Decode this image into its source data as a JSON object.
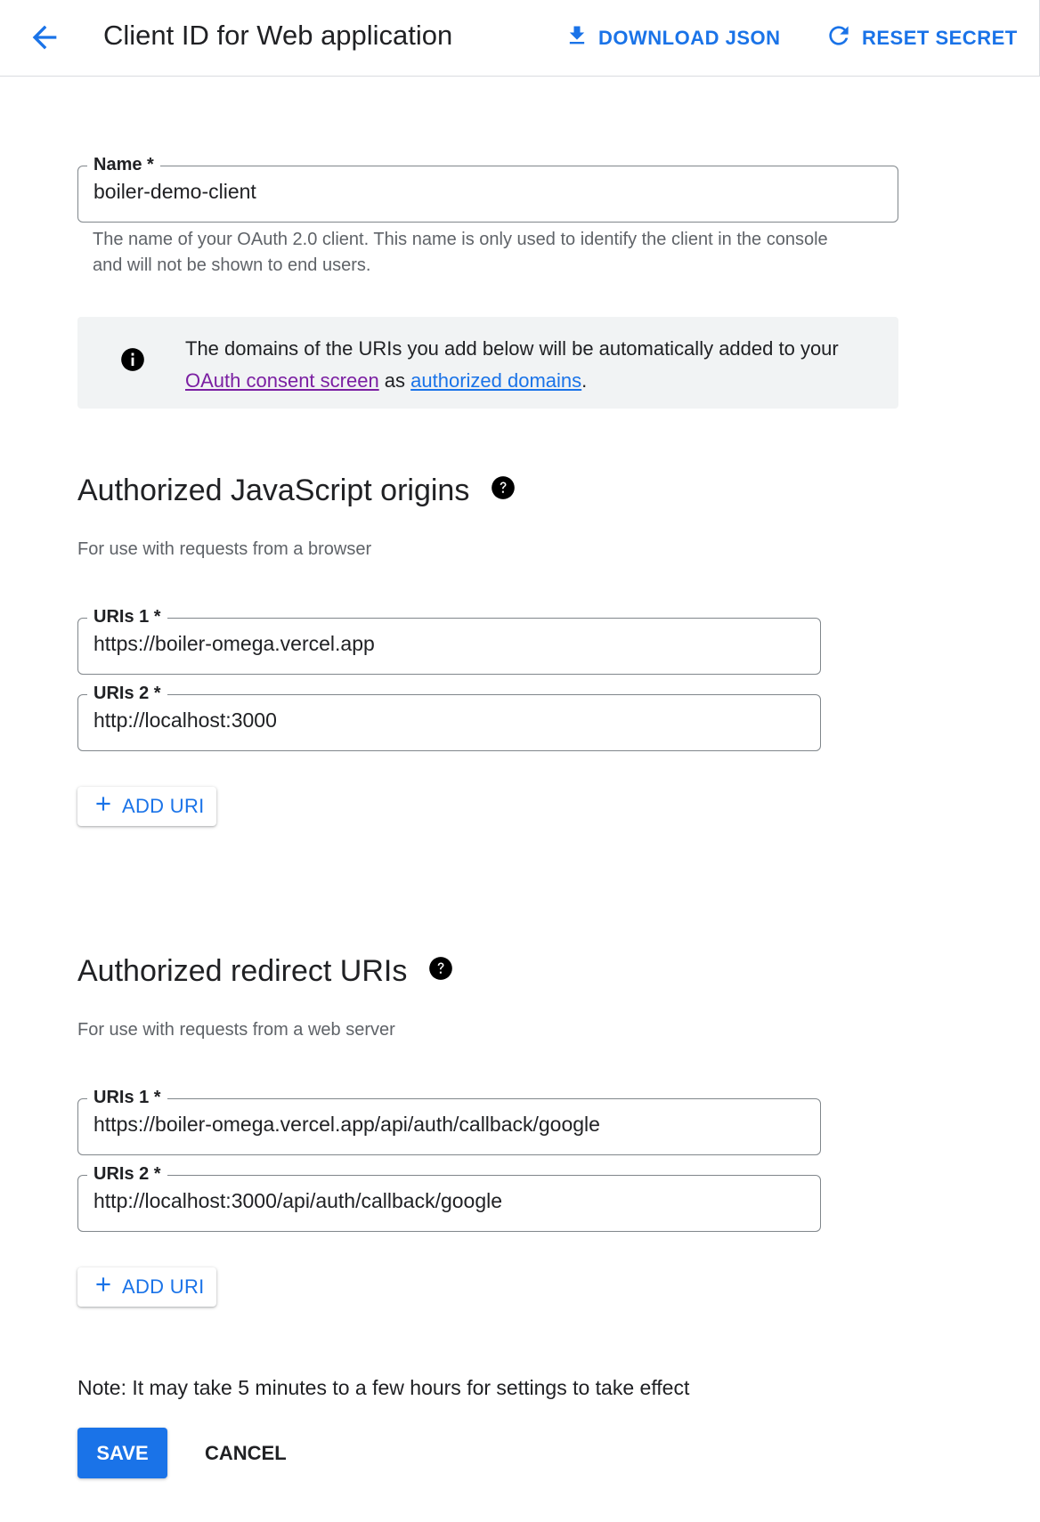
{
  "header": {
    "title": "Client ID for Web application",
    "download_label": "DOWNLOAD JSON",
    "reset_label": "RESET SECRET",
    "accent_color": "#1a73e8"
  },
  "name_field": {
    "label": "Name *",
    "value": "boiler-demo-client",
    "helper": "The name of your OAuth 2.0 client. This name is only used to identify the client in the console and will not be shown to end users."
  },
  "info": {
    "text_before": "The domains of the URIs you add below will be automatically added to your ",
    "link1": "OAuth consent screen",
    "text_middle": " as ",
    "link2": "authorized domains",
    "text_after": "."
  },
  "js_origins": {
    "title": "Authorized JavaScript origins",
    "subtitle": "For use with requests from a browser",
    "uris": [
      {
        "label": "URIs 1 *",
        "value": "https://boiler-omega.vercel.app"
      },
      {
        "label": "URIs 2 *",
        "value": "http://localhost:3000"
      }
    ],
    "add_label": "ADD URI"
  },
  "redirect_uris": {
    "title": "Authorized redirect URIs",
    "subtitle": "For use with requests from a web server",
    "uris": [
      {
        "label": "URIs 1 *",
        "value": "https://boiler-omega.vercel.app/api/auth/callback/google"
      },
      {
        "label": "URIs 2 *",
        "value": "http://localhost:3000/api/auth/callback/google"
      }
    ],
    "add_label": "ADD URI"
  },
  "note": "Note: It may take 5 minutes to a few hours for settings to take effect",
  "actions": {
    "save": "SAVE",
    "cancel": "CANCEL"
  }
}
